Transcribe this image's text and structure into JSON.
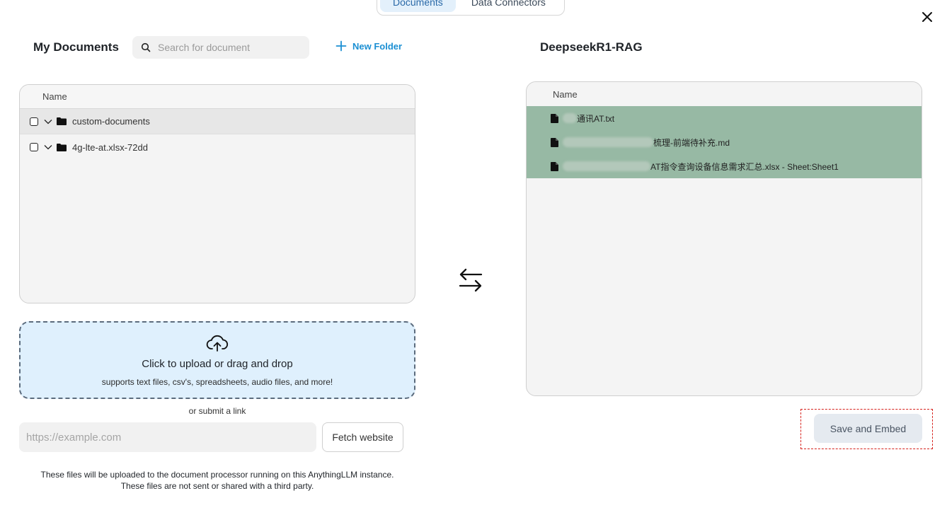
{
  "tabs": [
    {
      "label": "Documents",
      "active": true
    },
    {
      "label": "Data Connectors",
      "active": false
    }
  ],
  "left": {
    "title": "My Documents",
    "search_placeholder": "Search for document",
    "new_folder_label": "New Folder",
    "table_header": "Name",
    "folders": [
      {
        "name": "custom-documents",
        "selected": true
      },
      {
        "name": "4g-lte-at.xlsx-72dd",
        "selected": false
      }
    ]
  },
  "upload": {
    "title": "Click to upload or drag and drop",
    "subtitle": "supports text files, csv's, spreadsheets, audio files, and more!"
  },
  "link": {
    "or_text": "or submit a link",
    "url_placeholder": "https://example.com",
    "fetch_label": "Fetch website"
  },
  "disclaimer": {
    "line1": "These files will be uploaded to the document processor running on this AnythingLLM instance.",
    "line2": "These files are not sent or shared with a third party."
  },
  "right": {
    "title": "DeepseekR1-RAG",
    "table_header": "Name",
    "files": [
      {
        "name": "通讯AT.txt"
      },
      {
        "name": "梳理-前端待补充.md"
      },
      {
        "name": "AT指令查询设备信息需求汇总.xlsx - Sheet:Sheet1"
      }
    ],
    "row_highlight_color": "#97b9a4"
  },
  "save_label": "Save and Embed",
  "colors": {
    "accent_blue": "#1b8fd3",
    "upload_bg": "#dff0fd",
    "annotation_red": "#d6201b"
  }
}
